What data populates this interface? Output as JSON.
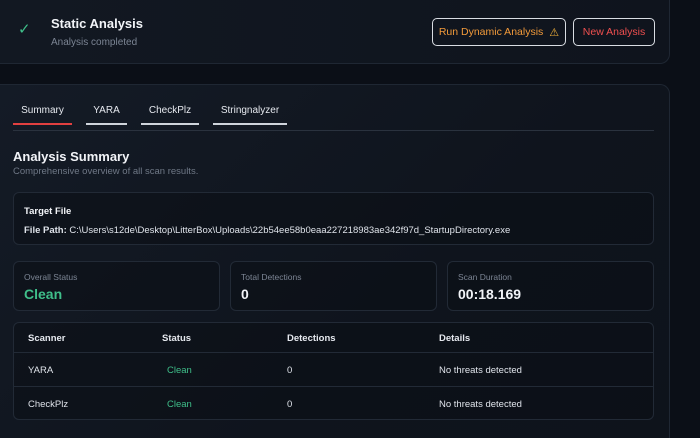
{
  "header": {
    "status_icon": "check-icon",
    "title": "Static Analysis",
    "subtitle": "Analysis completed",
    "dynamic_button_label": "Run Dynamic Analysis",
    "dynamic_button_icon": "warning-icon",
    "new_button_label": "New Analysis"
  },
  "tabs": [
    {
      "label": "Summary",
      "active": true
    },
    {
      "label": "YARA",
      "active": false
    },
    {
      "label": "CheckPlz",
      "active": false
    },
    {
      "label": "Stringnalyzer",
      "active": false
    }
  ],
  "summary": {
    "title": "Analysis Summary",
    "subtitle": "Comprehensive overview of all scan results."
  },
  "target": {
    "heading": "Target File",
    "path_label": "File Path:",
    "path": "C:\\Users\\s12de\\Desktop\\LitterBox\\Uploads\\22b54ee58b0eaa227218983ae342f97d_StartupDirectory.exe"
  },
  "stats": {
    "overall_label": "Overall Status",
    "overall_value": "Clean",
    "detections_label": "Total Detections",
    "detections_value": "0",
    "duration_label": "Scan Duration",
    "duration_value": "00:18.169"
  },
  "table": {
    "headers": [
      "Scanner",
      "Status",
      "Detections",
      "Details"
    ],
    "rows": [
      {
        "scanner": "YARA",
        "status": "Clean",
        "detections": "0",
        "details": "No threats detected"
      },
      {
        "scanner": "CheckPlz",
        "status": "Clean",
        "detections": "0",
        "details": "No threats detected"
      }
    ]
  },
  "colors": {
    "accent_red": "#e24040",
    "clean_green": "#3fbf8a",
    "warning_orange": "#f29a3a"
  }
}
